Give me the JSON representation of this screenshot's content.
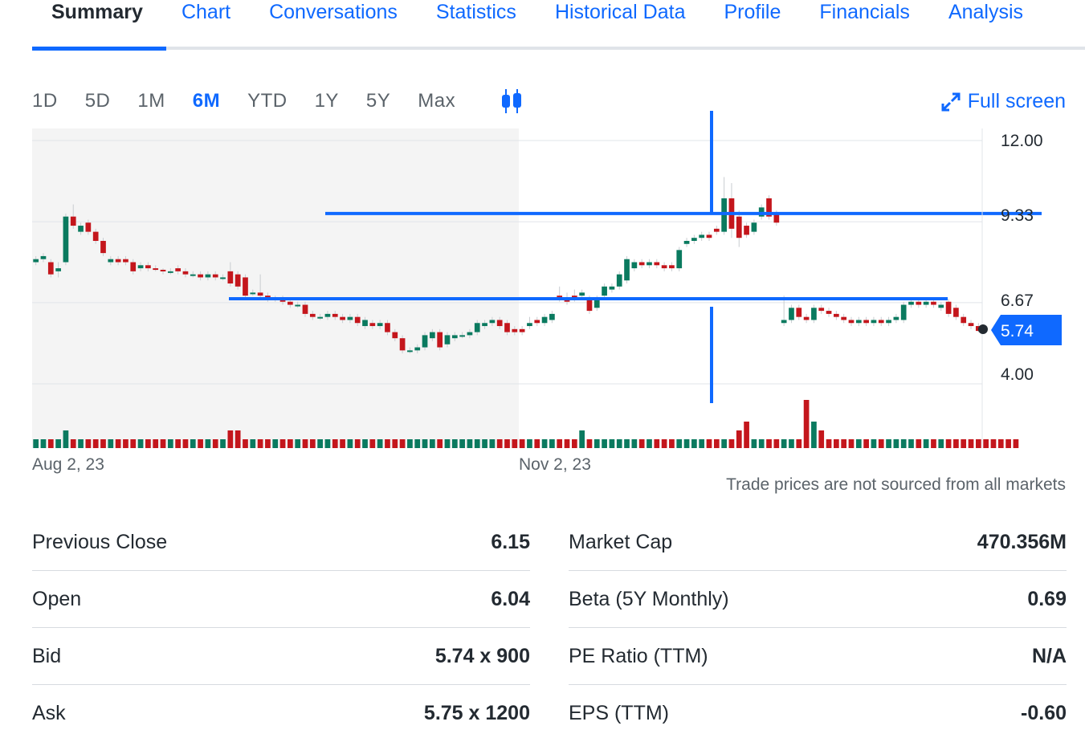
{
  "tabs": [
    {
      "label": "Summary",
      "active": true
    },
    {
      "label": "Chart"
    },
    {
      "label": "Conversations"
    },
    {
      "label": "Statistics"
    },
    {
      "label": "Historical Data"
    },
    {
      "label": "Profile"
    },
    {
      "label": "Financials"
    },
    {
      "label": "Analysis"
    }
  ],
  "ranges": [
    "1D",
    "5D",
    "1M",
    "6M",
    "YTD",
    "1Y",
    "5Y",
    "Max"
  ],
  "active_range": "6M",
  "chart_type_icon": "candlestick-icon",
  "fullscreen_label": "Full screen",
  "disclaimer": "Trade prices are not sourced from all markets",
  "colors": {
    "accent": "#0f69ff",
    "up": "#0a7a5f",
    "down": "#c4161c",
    "current_price_badge": "#0f69ff"
  },
  "chart_data": {
    "type": "bar",
    "subtype": "candlestick-with-volume",
    "x_tick_labels": [
      "Aug 2, 23",
      "Nov 2, 23"
    ],
    "y_tick_labels": [
      "12.00",
      "9.33",
      "6.67",
      "4.00"
    ],
    "ylim": [
      4.0,
      12.0
    ],
    "current_price": "5.74",
    "shaded_region": "Aug 2, 23 to Nov 2, 23",
    "grid": true,
    "annotations": [
      {
        "type": "horizontal-line",
        "value": 9.6
      },
      {
        "type": "horizontal-line",
        "value": 6.8
      },
      {
        "type": "vertical-line"
      }
    ],
    "candles": [
      {
        "o": 8.0,
        "c": 8.1,
        "h": 8.2,
        "l": 7.9
      },
      {
        "o": 8.1,
        "c": 8.2,
        "h": 8.3,
        "l": 8.0
      },
      {
        "o": 8.0,
        "c": 7.6,
        "h": 8.1,
        "l": 7.5
      },
      {
        "o": 7.7,
        "c": 7.8,
        "h": 8.0,
        "l": 7.5
      },
      {
        "o": 8.0,
        "c": 9.5,
        "h": 9.6,
        "l": 7.9
      },
      {
        "o": 9.5,
        "c": 9.2,
        "h": 9.9,
        "l": 9.1
      },
      {
        "o": 9.0,
        "c": 9.2,
        "h": 9.3,
        "l": 8.9
      },
      {
        "o": 9.3,
        "c": 9.0,
        "h": 9.4,
        "l": 8.9
      },
      {
        "o": 9.0,
        "c": 8.7,
        "h": 9.1,
        "l": 8.6
      },
      {
        "o": 8.7,
        "c": 8.3,
        "h": 8.8,
        "l": 8.2
      },
      {
        "o": 8.0,
        "c": 8.1,
        "h": 8.2,
        "l": 7.9
      },
      {
        "o": 8.1,
        "c": 8.0,
        "h": 8.2,
        "l": 7.9
      },
      {
        "o": 8.1,
        "c": 8.0,
        "h": 8.2,
        "l": 7.9
      },
      {
        "o": 8.0,
        "c": 7.7,
        "h": 8.1,
        "l": 7.6
      },
      {
        "o": 7.8,
        "c": 7.9,
        "h": 8.0,
        "l": 7.7
      },
      {
        "o": 7.9,
        "c": 7.8,
        "h": 8.0,
        "l": 7.7
      },
      {
        "o": 7.8,
        "c": 7.75,
        "h": 7.9,
        "l": 7.7
      },
      {
        "o": 7.75,
        "c": 7.7,
        "h": 7.8,
        "l": 7.6
      },
      {
        "o": 7.7,
        "c": 7.7,
        "h": 7.8,
        "l": 7.6
      },
      {
        "o": 7.8,
        "c": 7.7,
        "h": 7.9,
        "l": 7.6
      },
      {
        "o": 7.7,
        "c": 7.6,
        "h": 7.8,
        "l": 7.5
      },
      {
        "o": 7.6,
        "c": 7.6,
        "h": 7.7,
        "l": 7.5
      },
      {
        "o": 7.6,
        "c": 7.5,
        "h": 7.7,
        "l": 7.4
      },
      {
        "o": 7.5,
        "c": 7.6,
        "h": 7.7,
        "l": 7.4
      },
      {
        "o": 7.6,
        "c": 7.5,
        "h": 7.7,
        "l": 7.4
      },
      {
        "o": 7.5,
        "c": 7.5,
        "h": 7.6,
        "l": 7.4
      },
      {
        "o": 7.7,
        "c": 7.3,
        "h": 8.0,
        "l": 7.2
      },
      {
        "o": 7.6,
        "c": 7.2,
        "h": 7.7,
        "l": 7.1
      },
      {
        "o": 7.5,
        "c": 6.9,
        "h": 7.6,
        "l": 6.8
      },
      {
        "o": 7.0,
        "c": 7.0,
        "h": 7.1,
        "l": 6.9
      },
      {
        "o": 7.0,
        "c": 6.9,
        "h": 7.6,
        "l": 6.8
      },
      {
        "o": 6.9,
        "c": 6.8,
        "h": 7.0,
        "l": 6.7
      },
      {
        "o": 6.8,
        "c": 6.8,
        "h": 6.9,
        "l": 6.7
      },
      {
        "o": 6.8,
        "c": 6.7,
        "h": 6.9,
        "l": 6.6
      },
      {
        "o": 6.7,
        "c": 6.6,
        "h": 6.8,
        "l": 6.5
      },
      {
        "o": 6.6,
        "c": 6.6,
        "h": 6.7,
        "l": 6.5
      },
      {
        "o": 6.6,
        "c": 6.3,
        "h": 6.7,
        "l": 6.2
      },
      {
        "o": 6.3,
        "c": 6.2,
        "h": 6.4,
        "l": 6.1
      },
      {
        "o": 6.2,
        "c": 6.2,
        "h": 6.3,
        "l": 6.1
      },
      {
        "o": 6.2,
        "c": 6.3,
        "h": 6.4,
        "l": 6.1
      },
      {
        "o": 6.3,
        "c": 6.2,
        "h": 6.4,
        "l": 6.1
      },
      {
        "o": 6.2,
        "c": 6.1,
        "h": 6.3,
        "l": 6.0
      },
      {
        "o": 6.1,
        "c": 6.2,
        "h": 6.3,
        "l": 6.0
      },
      {
        "o": 6.2,
        "c": 6.0,
        "h": 6.3,
        "l": 5.9
      },
      {
        "o": 5.9,
        "c": 6.1,
        "h": 6.2,
        "l": 5.8
      },
      {
        "o": 6.0,
        "c": 5.9,
        "h": 6.1,
        "l": 5.8
      },
      {
        "o": 5.9,
        "c": 6.0,
        "h": 6.1,
        "l": 5.8
      },
      {
        "o": 6.0,
        "c": 5.7,
        "h": 6.1,
        "l": 5.6
      },
      {
        "o": 5.7,
        "c": 5.5,
        "h": 5.8,
        "l": 5.4
      },
      {
        "o": 5.5,
        "c": 5.1,
        "h": 5.6,
        "l": 5.0
      },
      {
        "o": 5.1,
        "c": 5.1,
        "h": 5.2,
        "l": 5.0
      },
      {
        "o": 5.1,
        "c": 5.2,
        "h": 5.3,
        "l": 5.0
      },
      {
        "o": 5.2,
        "c": 5.6,
        "h": 5.7,
        "l": 5.1
      },
      {
        "o": 5.5,
        "c": 5.7,
        "h": 5.8,
        "l": 5.4
      },
      {
        "o": 5.7,
        "c": 5.2,
        "h": 5.8,
        "l": 5.1
      },
      {
        "o": 5.3,
        "c": 5.6,
        "h": 5.7,
        "l": 5.2
      },
      {
        "o": 5.5,
        "c": 5.6,
        "h": 5.7,
        "l": 5.4
      },
      {
        "o": 5.6,
        "c": 5.6,
        "h": 5.7,
        "l": 5.5
      },
      {
        "o": 5.6,
        "c": 5.7,
        "h": 5.8,
        "l": 5.5
      },
      {
        "o": 5.7,
        "c": 6.0,
        "h": 6.1,
        "l": 5.6
      },
      {
        "o": 5.9,
        "c": 6.0,
        "h": 6.1,
        "l": 5.8
      },
      {
        "o": 6.0,
        "c": 6.1,
        "h": 6.2,
        "l": 5.9
      },
      {
        "o": 6.1,
        "c": 5.9,
        "h": 6.2,
        "l": 5.8
      },
      {
        "o": 6.0,
        "c": 5.7,
        "h": 6.1,
        "l": 5.6
      },
      {
        "o": 5.8,
        "c": 5.7,
        "h": 5.9,
        "l": 5.6
      },
      {
        "o": 5.8,
        "c": 5.7,
        "h": 5.9,
        "l": 5.6
      },
      {
        "o": 5.9,
        "c": 6.0,
        "h": 6.2,
        "l": 5.8
      },
      {
        "o": 6.1,
        "c": 6.0,
        "h": 6.2,
        "l": 5.9
      },
      {
        "o": 6.0,
        "c": 6.2,
        "h": 6.3,
        "l": 5.9
      },
      {
        "o": 6.1,
        "c": 6.3,
        "h": 6.4,
        "l": 6.0
      },
      {
        "o": 6.9,
        "c": 6.8,
        "h": 7.2,
        "l": 6.7
      },
      {
        "o": 6.8,
        "c": 6.7,
        "h": 7.0,
        "l": 6.6
      },
      {
        "o": 6.9,
        "c": 6.8,
        "h": 7.1,
        "l": 6.7
      },
      {
        "o": 6.9,
        "c": 7.0,
        "h": 7.1,
        "l": 6.8
      },
      {
        "o": 6.8,
        "c": 6.4,
        "h": 6.9,
        "l": 6.3
      },
      {
        "o": 6.5,
        "c": 6.8,
        "h": 6.9,
        "l": 6.4
      },
      {
        "o": 6.9,
        "c": 7.2,
        "h": 7.3,
        "l": 6.8
      },
      {
        "o": 7.1,
        "c": 7.2,
        "h": 7.3,
        "l": 7.0
      },
      {
        "o": 7.2,
        "c": 7.6,
        "h": 7.7,
        "l": 7.1
      },
      {
        "o": 7.4,
        "c": 8.1,
        "h": 8.2,
        "l": 7.3
      },
      {
        "o": 7.8,
        "c": 8.0,
        "h": 8.1,
        "l": 7.7
      },
      {
        "o": 8.0,
        "c": 7.9,
        "h": 8.1,
        "l": 7.8
      },
      {
        "o": 7.9,
        "c": 8.0,
        "h": 8.1,
        "l": 7.8
      },
      {
        "o": 8.0,
        "c": 7.9,
        "h": 8.1,
        "l": 7.8
      },
      {
        "o": 7.9,
        "c": 7.8,
        "h": 8.0,
        "l": 7.7
      },
      {
        "o": 7.9,
        "c": 7.8,
        "h": 8.0,
        "l": 7.7
      },
      {
        "o": 7.8,
        "c": 8.4,
        "h": 8.5,
        "l": 7.7
      },
      {
        "o": 8.6,
        "c": 8.7,
        "h": 8.8,
        "l": 8.5
      },
      {
        "o": 8.7,
        "c": 8.8,
        "h": 8.9,
        "l": 8.6
      },
      {
        "o": 8.8,
        "c": 8.9,
        "h": 9.0,
        "l": 8.7
      },
      {
        "o": 8.9,
        "c": 8.8,
        "h": 9.0,
        "l": 8.7
      },
      {
        "o": 9.1,
        "c": 9.0,
        "h": 9.2,
        "l": 8.9
      },
      {
        "o": 9.0,
        "c": 10.1,
        "h": 10.8,
        "l": 8.9
      },
      {
        "o": 10.1,
        "c": 9.1,
        "h": 10.6,
        "l": 8.8
      },
      {
        "o": 9.5,
        "c": 8.8,
        "h": 9.7,
        "l": 8.5
      },
      {
        "o": 9.2,
        "c": 8.9,
        "h": 9.3,
        "l": 8.8
      },
      {
        "o": 9.0,
        "c": 9.3,
        "h": 9.4,
        "l": 8.9
      },
      {
        "o": 9.5,
        "c": 9.8,
        "h": 9.9,
        "l": 9.4
      },
      {
        "o": 10.1,
        "c": 9.5,
        "h": 10.2,
        "l": 9.4
      },
      {
        "o": 9.6,
        "c": 9.3,
        "h": 9.7,
        "l": 9.2
      },
      {
        "o": 6.0,
        "c": 6.1,
        "h": 6.9,
        "l": 5.9
      },
      {
        "o": 6.1,
        "c": 6.5,
        "h": 6.6,
        "l": 6.0
      },
      {
        "o": 6.5,
        "c": 6.2,
        "h": 6.6,
        "l": 6.1
      },
      {
        "o": 6.2,
        "c": 6.1,
        "h": 6.3,
        "l": 6.0
      },
      {
        "o": 6.1,
        "c": 6.5,
        "h": 6.6,
        "l": 6.0
      },
      {
        "o": 6.5,
        "c": 6.4,
        "h": 6.6,
        "l": 6.3
      },
      {
        "o": 6.4,
        "c": 6.3,
        "h": 6.5,
        "l": 6.2
      },
      {
        "o": 6.3,
        "c": 6.2,
        "h": 6.4,
        "l": 6.1
      },
      {
        "o": 6.2,
        "c": 6.1,
        "h": 6.3,
        "l": 6.0
      },
      {
        "o": 6.1,
        "c": 6.0,
        "h": 6.2,
        "l": 5.9
      },
      {
        "o": 6.0,
        "c": 6.1,
        "h": 6.2,
        "l": 5.9
      },
      {
        "o": 6.1,
        "c": 6.0,
        "h": 6.2,
        "l": 5.9
      },
      {
        "o": 6.0,
        "c": 6.1,
        "h": 6.2,
        "l": 5.9
      },
      {
        "o": 6.1,
        "c": 6.0,
        "h": 6.2,
        "l": 5.9
      },
      {
        "o": 6.0,
        "c": 6.1,
        "h": 6.2,
        "l": 5.9
      },
      {
        "o": 6.1,
        "c": 6.2,
        "h": 6.3,
        "l": 6.0
      },
      {
        "o": 6.1,
        "c": 6.6,
        "h": 6.7,
        "l": 6.0
      },
      {
        "o": 6.6,
        "c": 6.7,
        "h": 6.8,
        "l": 6.5
      },
      {
        "o": 6.7,
        "c": 6.6,
        "h": 6.8,
        "l": 6.5
      },
      {
        "o": 6.6,
        "c": 6.7,
        "h": 6.8,
        "l": 6.5
      },
      {
        "o": 6.7,
        "c": 6.6,
        "h": 6.8,
        "l": 6.5
      },
      {
        "o": 6.5,
        "c": 6.6,
        "h": 6.7,
        "l": 6.4
      },
      {
        "o": 6.7,
        "c": 6.3,
        "h": 6.8,
        "l": 6.2
      },
      {
        "o": 6.5,
        "c": 6.2,
        "h": 6.6,
        "l": 6.1
      },
      {
        "o": 6.2,
        "c": 6.0,
        "h": 6.3,
        "l": 5.9
      },
      {
        "o": 6.0,
        "c": 5.9,
        "h": 6.1,
        "l": 5.8
      },
      {
        "o": 5.9,
        "c": 5.74,
        "h": 6.0,
        "l": 5.7
      }
    ],
    "volume": [
      1,
      1,
      1,
      1,
      2,
      1,
      1,
      1,
      1,
      1,
      1,
      1,
      1,
      1,
      1,
      1,
      1,
      1,
      1,
      1,
      1,
      1,
      1,
      1,
      1,
      1,
      2,
      2,
      1,
      1,
      1,
      1,
      1,
      1,
      1,
      1,
      1,
      1,
      1,
      1,
      1,
      1,
      1,
      1,
      1,
      1,
      1,
      1,
      1,
      1,
      1,
      1,
      1,
      1,
      1,
      1,
      1,
      1,
      1,
      1,
      1,
      1,
      1,
      1,
      1,
      1,
      1,
      1,
      1,
      1,
      1,
      1,
      1,
      2,
      1,
      1,
      1,
      1,
      1,
      1,
      1,
      1,
      1,
      1,
      1,
      1,
      1,
      1,
      1,
      1,
      1,
      1,
      1,
      1,
      2,
      3,
      1,
      1,
      1,
      1,
      1,
      1,
      1,
      6,
      3,
      2,
      1,
      1,
      1,
      1,
      1,
      1,
      1,
      1,
      1,
      1,
      1,
      1,
      1,
      1,
      1,
      1,
      1,
      1,
      1,
      1,
      1,
      1,
      1,
      1,
      1,
      1
    ]
  },
  "stats_left": [
    {
      "label": "Previous Close",
      "value": "6.15"
    },
    {
      "label": "Open",
      "value": "6.04"
    },
    {
      "label": "Bid",
      "value": "5.74 x 900"
    },
    {
      "label": "Ask",
      "value": "5.75 x 1200"
    }
  ],
  "stats_right": [
    {
      "label": "Market Cap",
      "value": "470.356M"
    },
    {
      "label": "Beta (5Y Monthly)",
      "value": "0.69"
    },
    {
      "label": "PE Ratio (TTM)",
      "value": "N/A"
    },
    {
      "label": "EPS (TTM)",
      "value": "-0.60"
    }
  ]
}
